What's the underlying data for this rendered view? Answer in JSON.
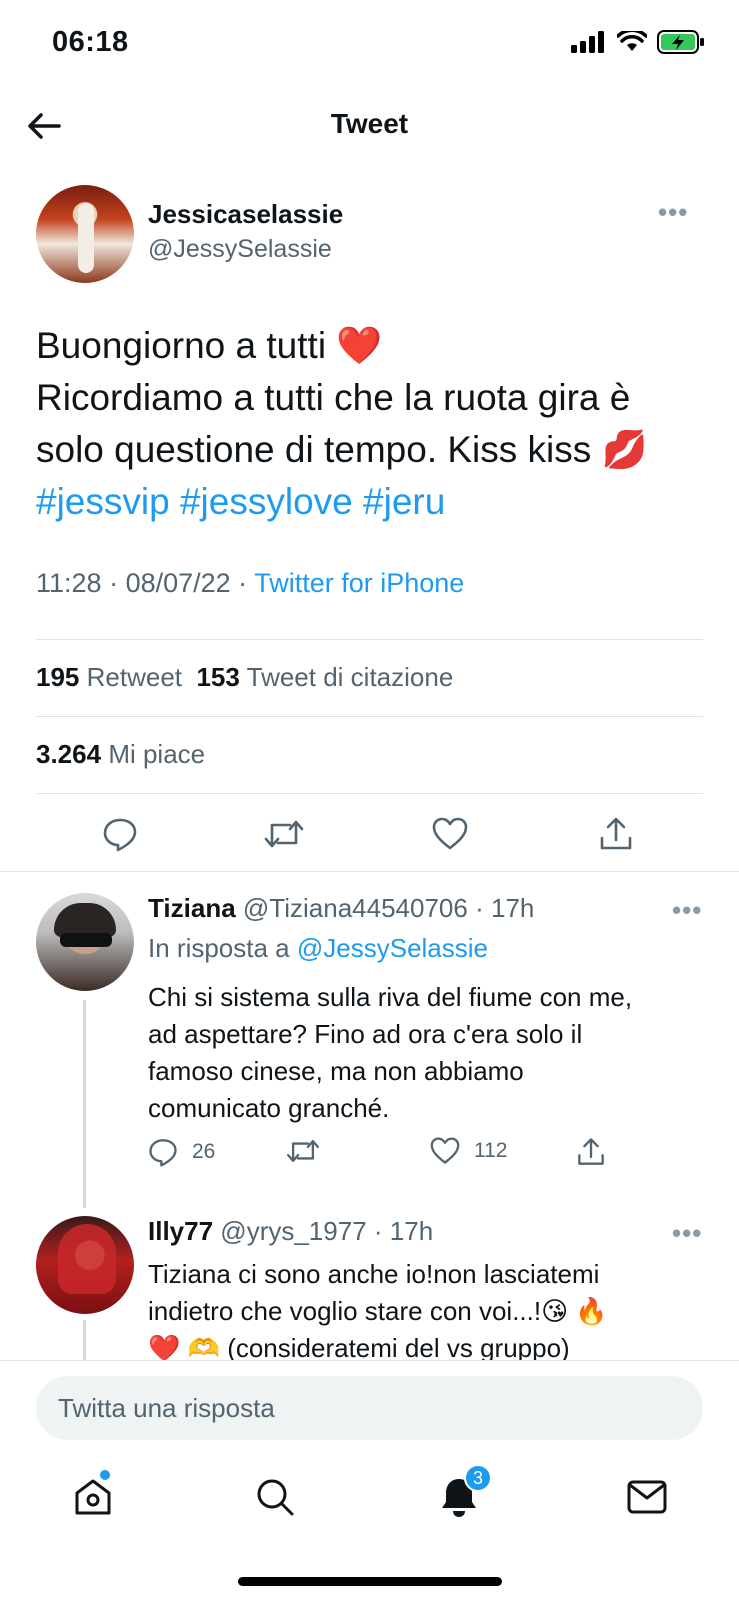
{
  "status_bar": {
    "time": "06:18"
  },
  "header": {
    "title": "Tweet"
  },
  "tweet": {
    "author_name": "Jessicaselassie",
    "author_handle": "@JessySelassie",
    "line1": "Buongiorno a tutti",
    "line1_emoji": "❤️",
    "line2": "Ricordiamo a tutti che la ruota gira è",
    "line3": "solo questione di tempo. Kiss kiss",
    "line3_emoji": "💋",
    "hashtags": [
      "#jessvip",
      "#jessylove",
      "#jeru"
    ],
    "time": "11:28",
    "date": "08/07/22",
    "source": "Twitter for iPhone",
    "retweets": "195",
    "retweets_label": "Retweet",
    "quotes": "153",
    "quotes_label": "Tweet di citazione",
    "likes": "3.264",
    "likes_label": "Mi piace"
  },
  "replies": [
    {
      "name": "Tiziana",
      "handle": "@Tiziana44540706",
      "age": "17h",
      "replying_prefix": "In risposta a",
      "replying_to": "@JessySelassie",
      "lines": [
        "Chi si sistema sulla riva del fiume con me,",
        "ad aspettare? Fino ad ora c'era solo il",
        "famoso cinese, ma non abbiamo",
        "comunicato granché."
      ],
      "reply_count": "26",
      "like_count": "112"
    },
    {
      "name": "Illy77",
      "handle": "@yrys_1977",
      "age": "17h",
      "lines": [
        "Tiziana ci sono anche io!non lasciatemi",
        "indietro che voglio stare con voi...!😘 🔥",
        "❤️ 🫶 (consideratemi del vs gruppo)"
      ]
    }
  ],
  "composer": {
    "placeholder": "Twitta una risposta"
  },
  "tab_bar": {
    "notifications_badge": "3"
  },
  "colors": {
    "accent": "#1d9bf0",
    "text": "#0f1419",
    "muted": "#536471",
    "battery": "#34c759"
  },
  "icons": [
    "back-arrow-icon",
    "more-icon",
    "reply-icon",
    "retweet-icon",
    "like-icon",
    "share-icon",
    "home-icon",
    "search-icon",
    "bell-icon",
    "mail-icon"
  ]
}
